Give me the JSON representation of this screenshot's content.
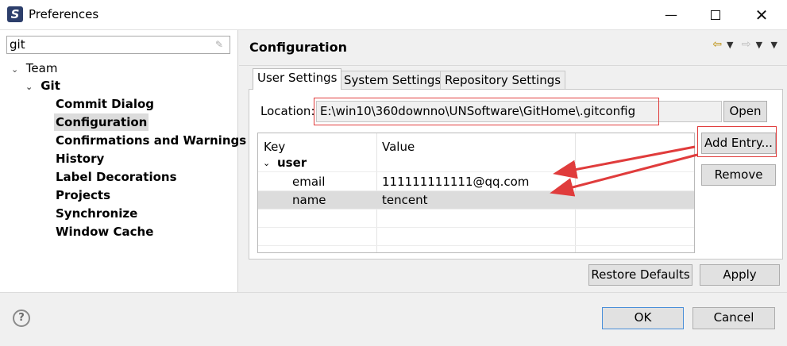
{
  "window": {
    "title": "Preferences",
    "app_icon": "eclipse-icon"
  },
  "filter": {
    "value": "git"
  },
  "tree": {
    "team": "Team",
    "git": "Git",
    "items": [
      "Commit Dialog",
      "Configuration",
      "Confirmations and Warnings",
      "History",
      "Label Decorations",
      "Projects",
      "Synchronize",
      "Window Cache"
    ]
  },
  "page": {
    "title": "Configuration"
  },
  "tabs": [
    "User Settings",
    "System Settings",
    "Repository Settings"
  ],
  "location": {
    "label": "Location:",
    "value": "E:\\win10\\360downno\\UNSoftware\\GitHome\\.gitconfig",
    "open_label": "Open"
  },
  "table": {
    "headers": [
      "Key",
      "Value"
    ],
    "group": "user",
    "rows": [
      {
        "key": "email",
        "value": "111111111111@qq.com"
      },
      {
        "key": "name",
        "value": "tencent"
      }
    ]
  },
  "buttons": {
    "add_entry": "Add Entry...",
    "remove": "Remove",
    "restore_defaults": "Restore Defaults",
    "apply": "Apply",
    "ok": "OK",
    "cancel": "Cancel"
  },
  "colors": {
    "annotation_red": "#e03c3c",
    "selection": "#dcdcdc",
    "ok_border": "#4a8fd9"
  }
}
